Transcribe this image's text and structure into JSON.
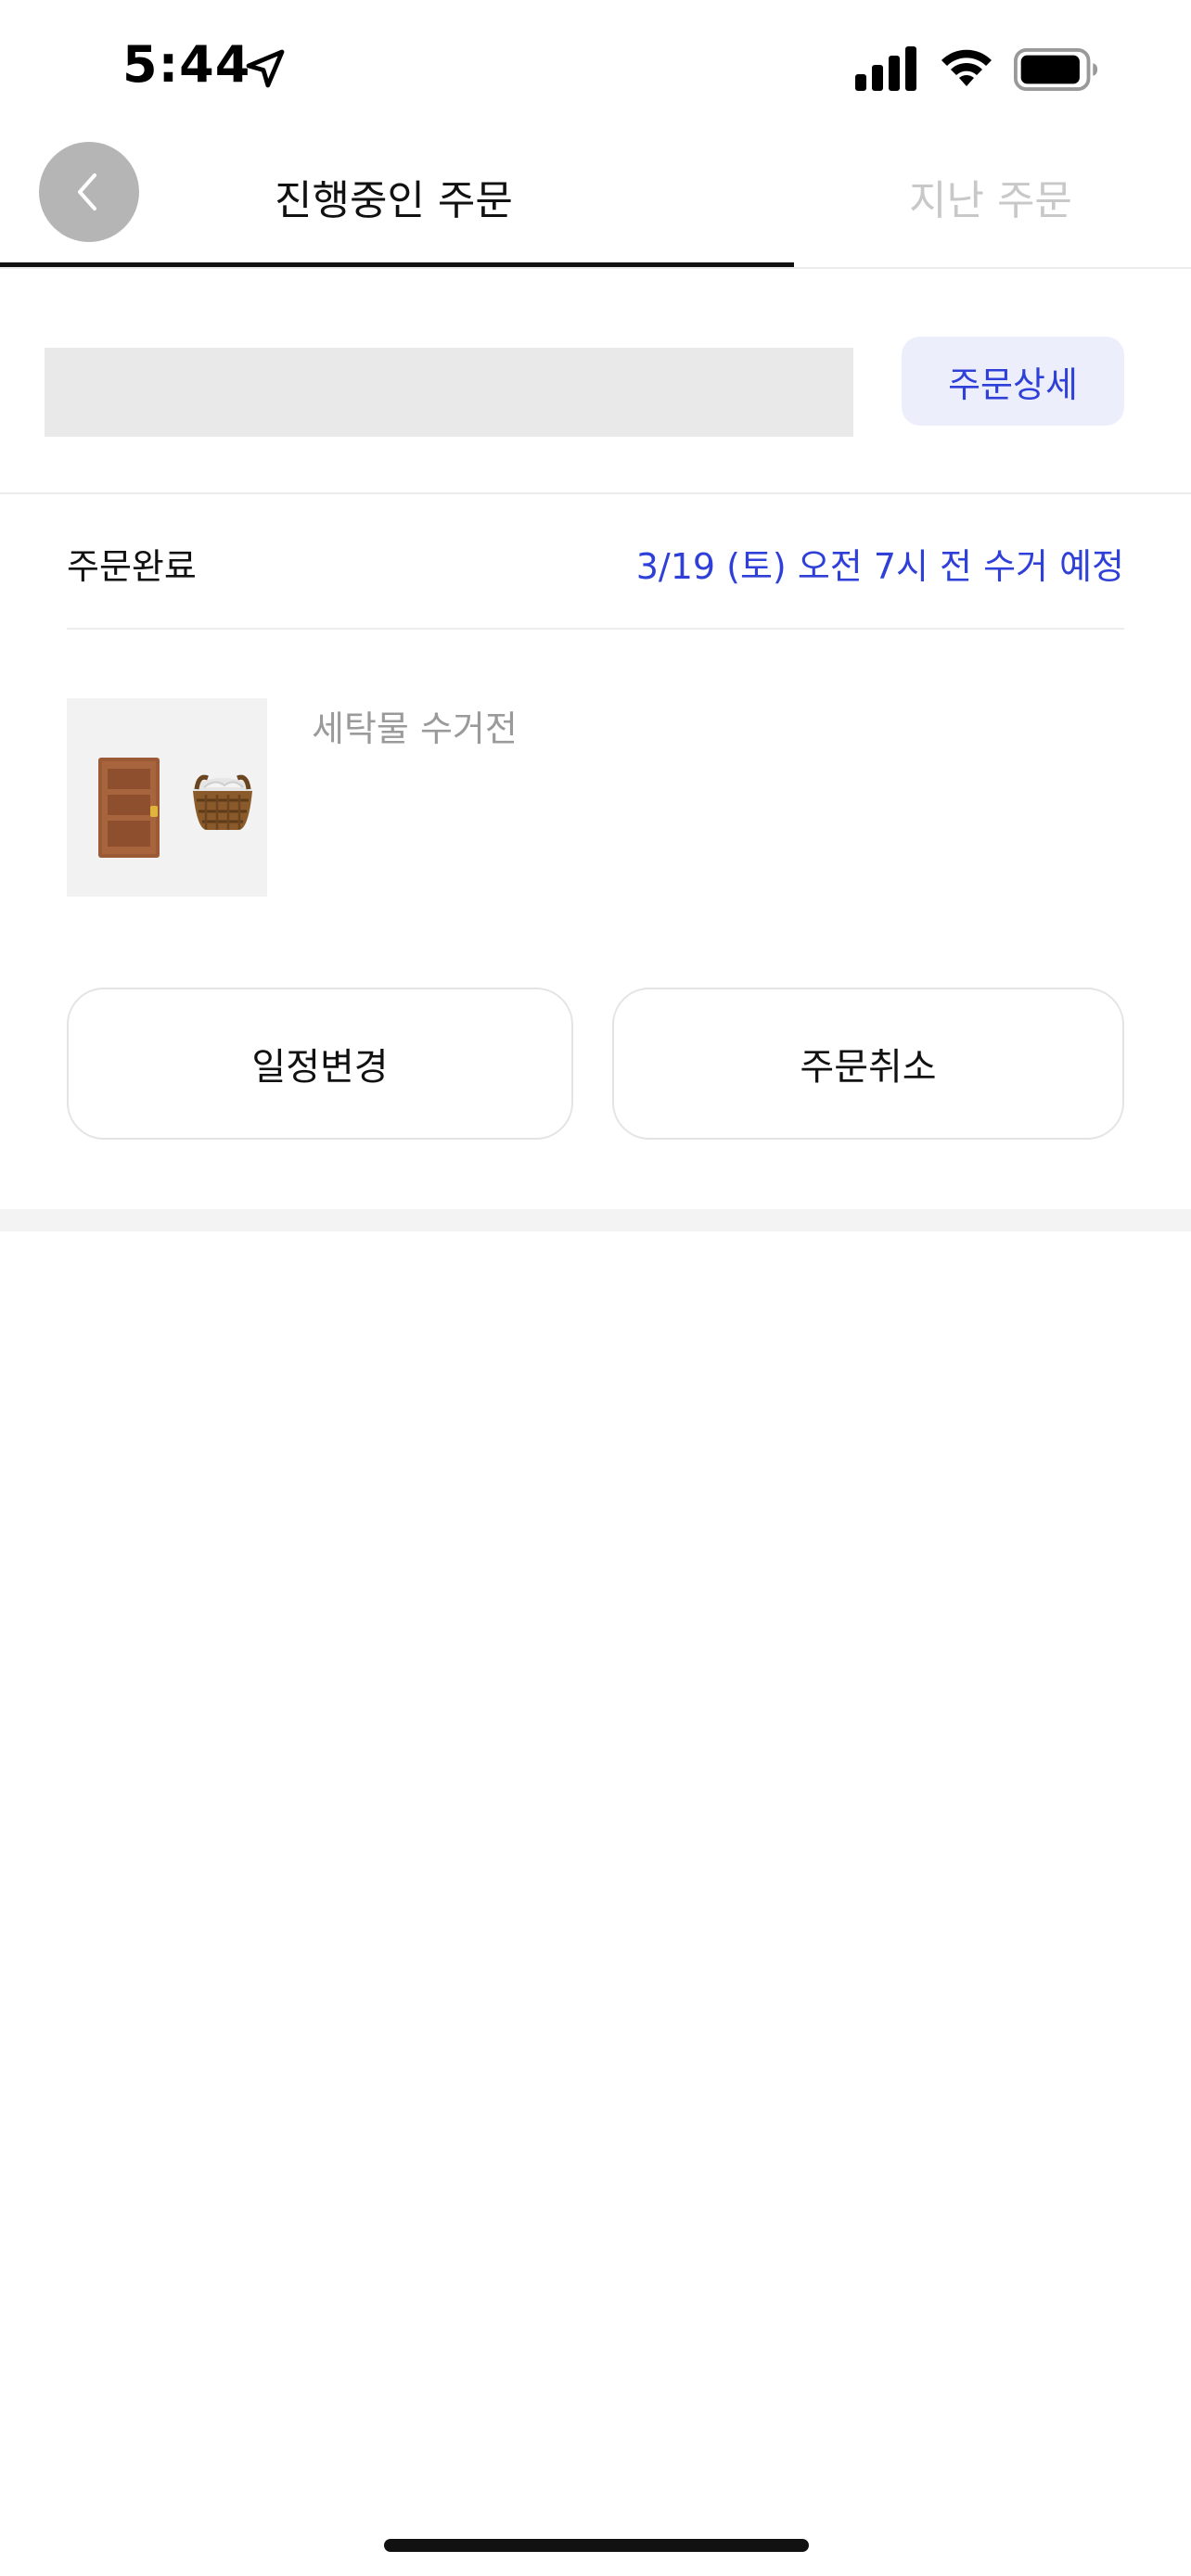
{
  "status_bar": {
    "time": "5:44",
    "icons": [
      "location-arrow-icon",
      "cellular-signal-icon",
      "wifi-icon",
      "battery-icon"
    ]
  },
  "header": {
    "tabs": [
      {
        "label": "진행중인 주문",
        "active": true
      },
      {
        "label": "지난 주문",
        "active": false
      }
    ],
    "back_icon": "chevron-left-icon"
  },
  "order": {
    "detail_button": "주문상세",
    "status_label": "주문완료",
    "pickup_time": "3/19 (토) 오전 7시 전 수거 예정",
    "item_status": "세탁물 수거전",
    "thumbnail_icons": [
      "door-icon",
      "laundry-basket-icon"
    ],
    "actions": {
      "reschedule": "일정변경",
      "cancel": "주문취소"
    }
  },
  "colors": {
    "accent": "#2f40d8",
    "accent_bg": "#eceefc",
    "inactive_tab": "#c8c8c8",
    "muted_text": "#9a9a9a"
  }
}
